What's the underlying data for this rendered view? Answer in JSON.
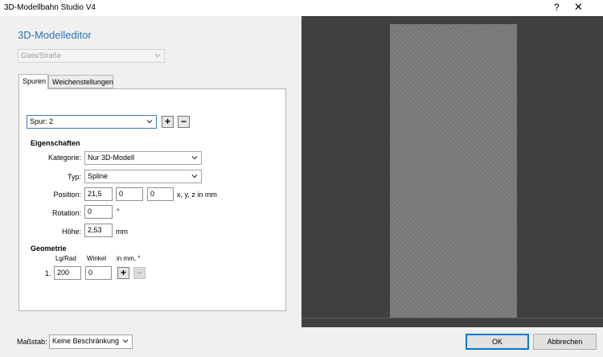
{
  "window": {
    "title": "3D-Modellbahn Studio V4",
    "help_label": "?",
    "close_label": "✕"
  },
  "editor": {
    "heading": "3D-Modelleditor",
    "type_select": "Gleis/Straße",
    "tabs": [
      "Spuren",
      "Weichenstellungen"
    ],
    "spur_select": "Spur: 2",
    "add_label": "+",
    "remove_label": "−",
    "eigenschaften": {
      "heading": "Eigenschaften",
      "kategorie_label": "Kategorie:",
      "kategorie_value": "Nur 3D-Modell",
      "typ_label": "Typ:",
      "typ_value": "Spline",
      "position_label": "Position:",
      "position_x": "21,5",
      "position_y": "0",
      "position_z": "0",
      "position_unit": "x, y, z in mm",
      "rotation_label": "Rotation:",
      "rotation_value": "0",
      "rotation_unit": "°",
      "hoehe_label": "Höhe:",
      "hoehe_value": "2,53",
      "hoehe_unit": "mm"
    },
    "geometrie": {
      "heading": "Geometrie",
      "col_lgrad": "Lg/Rad",
      "col_winkel": "Winkel",
      "col_unit": "in mm, °",
      "row_index": "1.",
      "row_lgrad": "200",
      "row_winkel": "0",
      "add_label": "+",
      "remove_label": "--"
    }
  },
  "footer": {
    "massstab_label": "Maßstab:",
    "massstab_value": "Keine Beschränkung",
    "ok_label": "OK",
    "cancel_label": "Abbrechen"
  },
  "colors": {
    "heading_blue": "#2c74b8",
    "preview_bg": "#404040",
    "track_gray": "#7a7a7a",
    "default_button_border": "#0078d7"
  }
}
